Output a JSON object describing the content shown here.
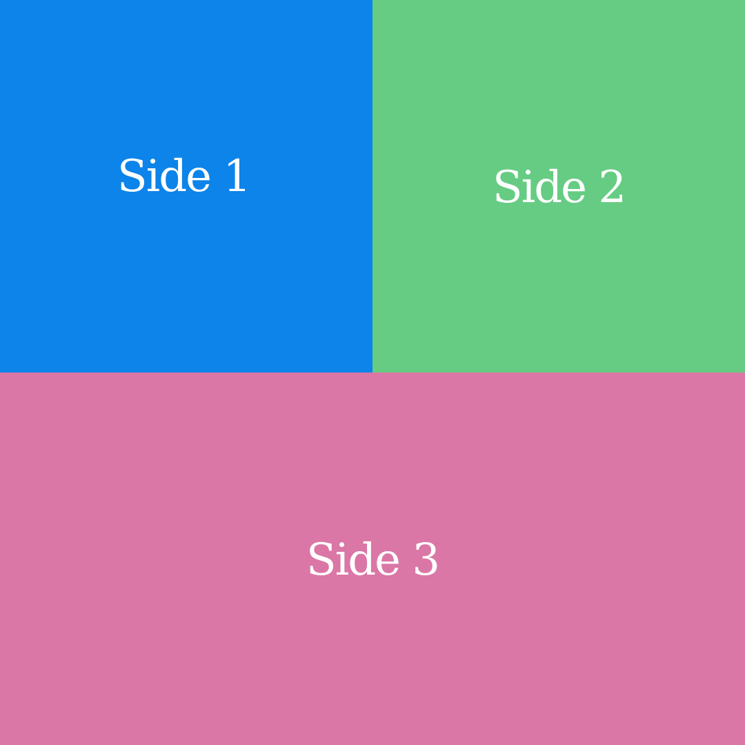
{
  "panels": [
    {
      "label": "Side 1",
      "color": "#0c84ea"
    },
    {
      "label": "Side 2",
      "color": "#66cc83"
    },
    {
      "label": "Side 3",
      "color": "#da77a6"
    }
  ]
}
